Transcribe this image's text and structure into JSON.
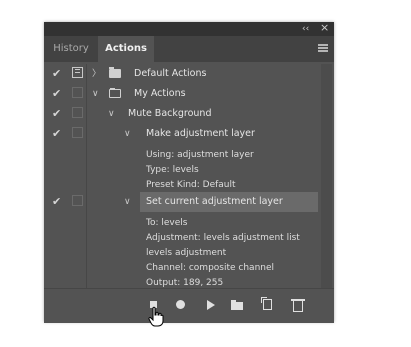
{
  "panel": {
    "collapse_glyph": "‹‹",
    "close_glyph": "×",
    "tabs": [
      {
        "label": "History"
      },
      {
        "label": "Actions"
      }
    ]
  },
  "rows": [
    {
      "label": "Default Actions",
      "checked": true,
      "dialog": true,
      "expanded": false,
      "icon": "folder-icon"
    },
    {
      "label": "My Actions",
      "checked": true,
      "dialog": false,
      "expanded": true,
      "icon": "folder-open-icon"
    },
    {
      "label": "Mute Background",
      "checked": true,
      "dialog": false,
      "expanded": true
    },
    {
      "label": "Make adjustment layer",
      "checked": true,
      "dialog": false,
      "expanded": true
    },
    {
      "label": "Set current adjustment layer",
      "checked": true,
      "dialog": false,
      "expanded": true,
      "selected": true
    }
  ],
  "details": {
    "make_adjustment_layer": [
      "Using: adjustment layer",
      "Type: levels",
      "Preset Kind: Default"
    ],
    "set_current_adjustment_layer": [
      "To: levels",
      "Adjustment: levels adjustment list",
      "levels adjustment",
      "Channel: composite channel",
      "Output: 189, 255"
    ]
  },
  "glyphs": {
    "check": "✔",
    "chevron_right": "〉",
    "chevron_down": "∨"
  },
  "toolbar": {
    "icons": [
      "stop-icon",
      "record-icon",
      "play-icon",
      "new-set-icon",
      "new-action-icon",
      "trash-icon"
    ]
  },
  "colors": {
    "panel_bg": "#535353",
    "tab_bar_bg": "#424242",
    "selected_row_bg": "#6e6e6e",
    "text": "#e6e6e6"
  }
}
